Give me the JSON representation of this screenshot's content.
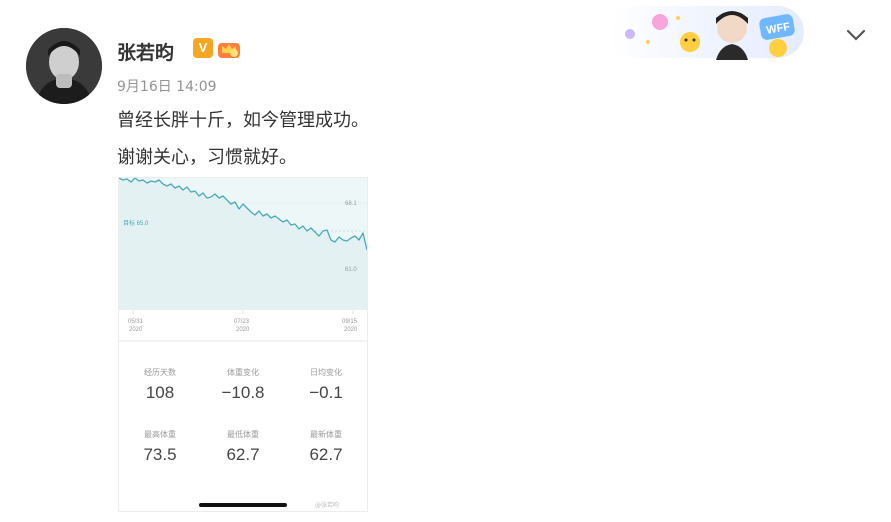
{
  "post": {
    "username": "张若昀",
    "verified_badge": "V",
    "timestamp": "9月16日 14:09",
    "lines": [
      "曾经长胖十斤，如今管理成功。",
      "谢谢关心，习惯就好。"
    ]
  },
  "banner": {
    "badge_text": "WFF"
  },
  "colors": {
    "accent": "#f5a623",
    "chart_line": "#4aa9b8",
    "chart_fill": "#eef7f8"
  },
  "screenshot": {
    "y_ticks": [
      "68.1",
      "61.0"
    ],
    "target_label": "目标 65.0",
    "x_ticks": [
      {
        "date": "05/31",
        "year": "2020"
      },
      {
        "date": "07/23",
        "year": "2020"
      },
      {
        "date": "09/15",
        "year": "2020"
      }
    ],
    "watermark": "@张若昀",
    "stats": [
      {
        "label": "经历天数",
        "value": "108"
      },
      {
        "label": "体重变化",
        "value": "−10.8"
      },
      {
        "label": "日均变化",
        "value": "−0.1"
      },
      {
        "label": "最高体重",
        "value": "73.5"
      },
      {
        "label": "最低体重",
        "value": "62.7"
      },
      {
        "label": "最新体重",
        "value": "62.7"
      }
    ]
  }
}
